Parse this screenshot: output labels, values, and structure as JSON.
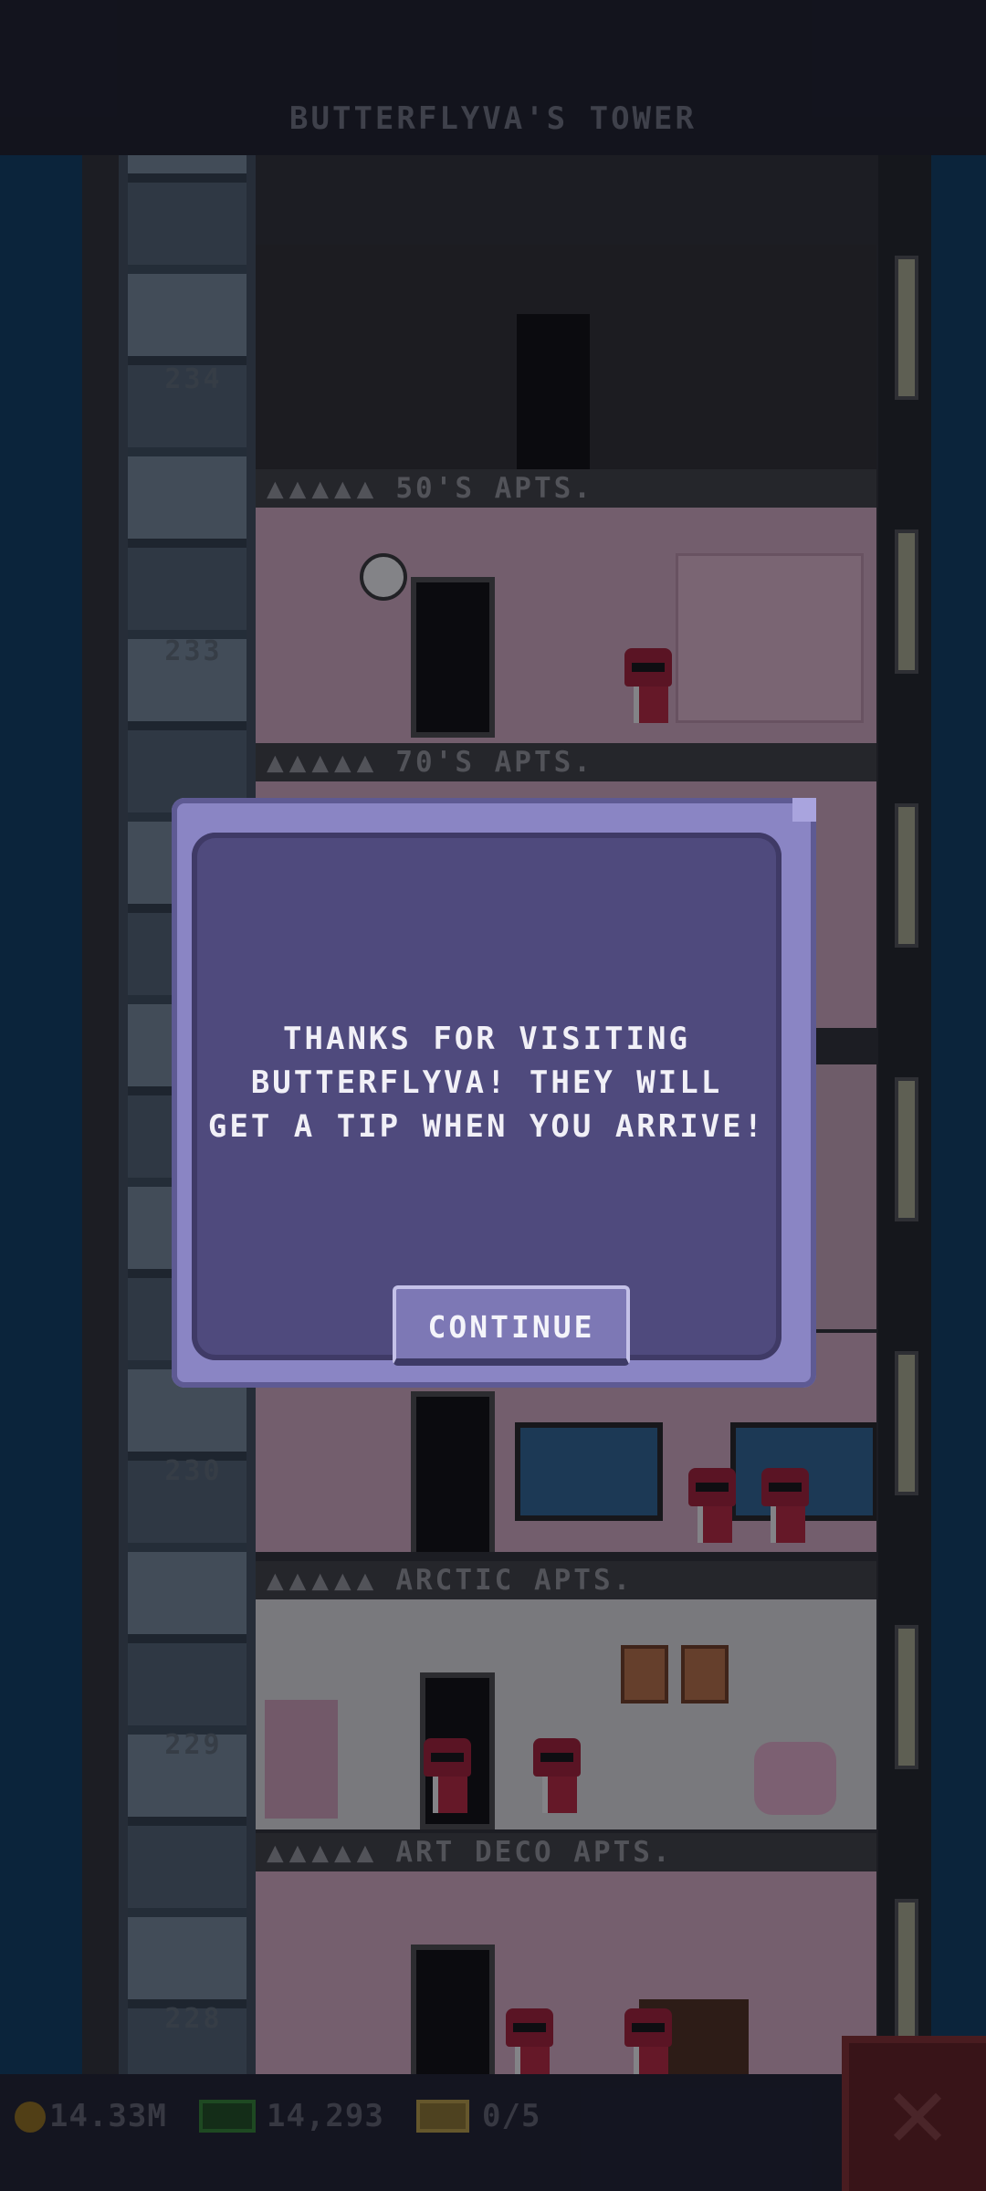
{
  "header": {
    "title": "BUTTERFLYVA'S TOWER"
  },
  "tower": {
    "floors": [
      {
        "number": "234",
        "label": "50'S APTS."
      },
      {
        "number": "233",
        "label": "70'S APTS."
      },
      {
        "number": "230",
        "label": "ARCTIC APTS."
      },
      {
        "number": "229",
        "label": "ART DECO APTS."
      },
      {
        "number": "228",
        "label": ""
      }
    ],
    "floor_dots": "▲▲▲▲▲"
  },
  "dialog": {
    "message_line1": "THANKS FOR VISITING",
    "message_line2": "BUTTERFLYVA! THEY WILL",
    "message_line3": "GET A TIP WHEN YOU ARRIVE!",
    "continue_label": "CONTINUE"
  },
  "status_bar": {
    "coins": "14.33M",
    "bux": "14,293",
    "tickets": "0/5"
  },
  "icons": {
    "coin": "coin-icon",
    "bux": "bux-icon",
    "ticket": "ticket-icon",
    "close": "close-icon"
  },
  "colors": {
    "dialog_frame": "#8a85c4",
    "dialog_panel": "#4f4a7d",
    "sky": "#0b3a5c",
    "close_button": "#5d1d1d"
  }
}
